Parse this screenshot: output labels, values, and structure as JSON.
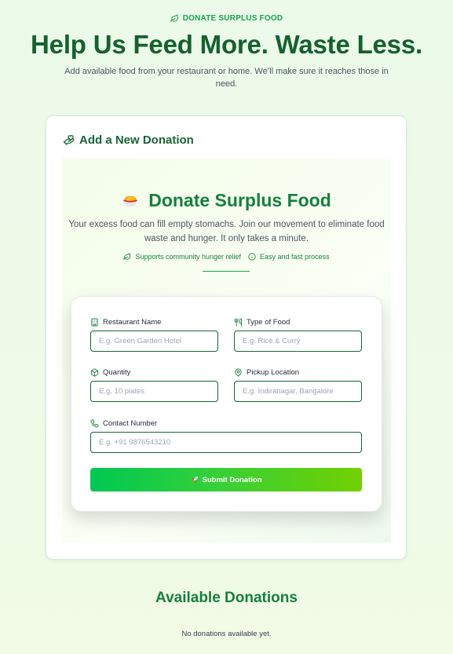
{
  "header": {
    "tag": "DONATE SURPLUS FOOD",
    "tag_icon": "leaf-icon",
    "title": "Help Us Feed More. Waste Less.",
    "subtitle": "Add available food from your restaurant or home. We’ll make sure it reaches those in need."
  },
  "card": {
    "title": "Add a New Donation",
    "title_icon": "hand-heart-icon"
  },
  "inner": {
    "title": "Donate Surplus Food",
    "title_icon": "food-bowl-icon",
    "subtitle": "Your excess food can fill empty stomachs. Join our movement to eliminate food waste and hunger. It only takes a minute.",
    "features": [
      {
        "icon": "leaf-icon",
        "label": "Supports community hunger relief"
      },
      {
        "icon": "info-icon",
        "label": "Easy and fast process"
      }
    ]
  },
  "form": {
    "restaurant_name": {
      "label": "Restaurant Name",
      "placeholder": "E.g. Green Garden Hotel",
      "icon": "building-icon"
    },
    "food_type": {
      "label": "Type of Food",
      "placeholder": "E.g. Rice & Curry",
      "icon": "utensils-icon"
    },
    "quantity": {
      "label": "Quantity",
      "placeholder": "E.g. 10 plates",
      "icon": "box-icon"
    },
    "pickup_location": {
      "label": "Pickup Location",
      "placeholder": "E.g. Indiranagar, Bangalore",
      "icon": "map-pin-icon"
    },
    "contact_number": {
      "label": "Contact Number",
      "placeholder": "E.g. +91 9876543210",
      "icon": "phone-icon"
    },
    "submit_label": "Submit Donation",
    "submit_icon": "rocket-icon"
  },
  "donations": {
    "title": "Available Donations",
    "empty_text": "No donations available yet."
  },
  "colors": {
    "primary_green": "#15803d",
    "dark_green": "#14612c",
    "button_gradient_start": "#00c853",
    "button_gradient_end": "#72d000"
  }
}
